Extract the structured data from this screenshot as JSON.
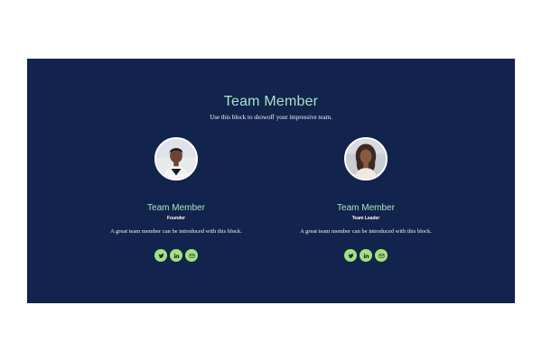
{
  "section": {
    "title": "Team Member",
    "subtitle": "Use this block to showoff your impressive team."
  },
  "members": [
    {
      "name": "Team Member",
      "role": "Founder",
      "bio": "A great team member can be introduced with this block.",
      "socials": [
        "twitter-icon",
        "linkedin-icon",
        "mail-icon"
      ]
    },
    {
      "name": "Team Member",
      "role": "Team Leader",
      "bio": "A great team member can be introduced with this block.",
      "socials": [
        "twitter-icon",
        "linkedin-icon",
        "mail-icon"
      ]
    }
  ],
  "colors": {
    "panel_bg": "#12234d",
    "accent_text": "#a9e3c3",
    "social_bg": "#a5e27a"
  }
}
